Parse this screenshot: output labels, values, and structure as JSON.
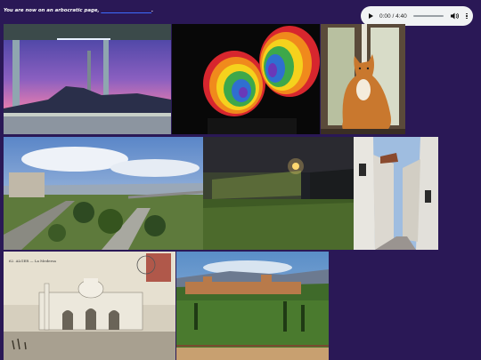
{
  "header": {
    "text": "You are now on an arbocratic page,",
    "link": "",
    "end": "."
  },
  "player": {
    "time": "0:00 / 4:40",
    "play_icon": "play-icon",
    "volume_icon": "volume-icon",
    "more_icon": "more-options-icon"
  },
  "photos": [
    {
      "name": "train-station-sunset-photo"
    },
    {
      "name": "rainbow-crochet-balls-photo"
    },
    {
      "name": "orange-cat-window-photo"
    },
    {
      "name": "river-valley-highway-photo"
    },
    {
      "name": "night-train-field-photo"
    },
    {
      "name": "whitewashed-village-street-photo"
    },
    {
      "name": "vintage-postcard-mosque-photo"
    },
    {
      "name": "alhambra-panorama-photo"
    }
  ],
  "postcard_caption": "62. ALGER — La Medersa"
}
